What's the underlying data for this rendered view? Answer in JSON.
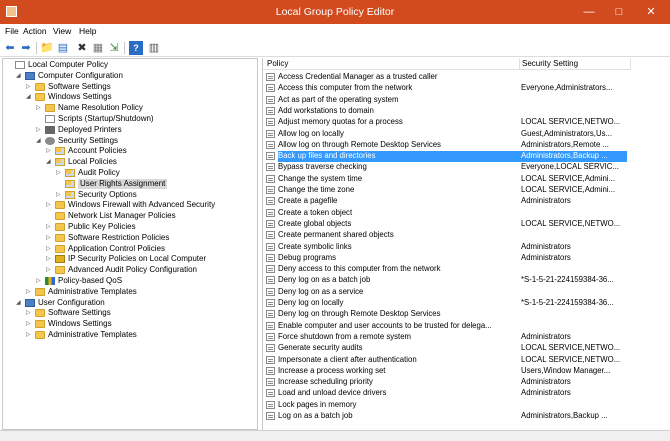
{
  "window": {
    "title": "Local Group Policy Editor",
    "minimize": "—",
    "maximize": "□",
    "close": "✕"
  },
  "menu": [
    "File",
    "Action",
    "View",
    "Help"
  ],
  "toolbar": [
    {
      "name": "back-icon",
      "glyph": "⬅"
    },
    {
      "name": "forward-icon",
      "glyph": "➡"
    },
    {
      "name": "up-folder-icon",
      "glyph": "📁"
    },
    {
      "name": "show-hide-tree-icon",
      "glyph": "▤"
    },
    {
      "name": "delete-icon",
      "glyph": "✖"
    },
    {
      "name": "properties-icon",
      "glyph": "▦"
    },
    {
      "name": "export-list-icon",
      "glyph": "⇲"
    },
    {
      "name": "help-icon",
      "glyph": "?"
    },
    {
      "name": "filter-icon",
      "glyph": "▥"
    }
  ],
  "tree": [
    {
      "label": "Local Computer Policy",
      "indent": 0,
      "arrow": "",
      "icon": "doc"
    },
    {
      "label": "Computer Configuration",
      "indent": 1,
      "arrow": "◢",
      "icon": "computer"
    },
    {
      "label": "Software Settings",
      "indent": 2,
      "arrow": "▷",
      "icon": "folder"
    },
    {
      "label": "Windows Settings",
      "indent": 2,
      "arrow": "◢",
      "icon": "folder"
    },
    {
      "label": "Name Resolution Policy",
      "indent": 3,
      "arrow": "▷",
      "icon": "folder"
    },
    {
      "label": "Scripts (Startup/Shutdown)",
      "indent": 3,
      "arrow": "",
      "icon": "doc"
    },
    {
      "label": "Deployed Printers",
      "indent": 3,
      "arrow": "▷",
      "icon": "printer"
    },
    {
      "label": "Security Settings",
      "indent": 3,
      "arrow": "◢",
      "icon": "gear"
    },
    {
      "label": "Account Policies",
      "indent": 4,
      "arrow": "▷",
      "icon": "policyfolder"
    },
    {
      "label": "Local Policies",
      "indent": 4,
      "arrow": "◢",
      "icon": "policyfolder"
    },
    {
      "label": "Audit Policy",
      "indent": 5,
      "arrow": "▷",
      "icon": "policyfolder"
    },
    {
      "label": "User Rights Assignment",
      "indent": 5,
      "arrow": "",
      "icon": "policyfolder",
      "selected": true
    },
    {
      "label": "Security Options",
      "indent": 5,
      "arrow": "▷",
      "icon": "policyfolder"
    },
    {
      "label": "Windows Firewall with Advanced Security",
      "indent": 4,
      "arrow": "▷",
      "icon": "folder"
    },
    {
      "label": "Network List Manager Policies",
      "indent": 4,
      "arrow": "",
      "icon": "folder"
    },
    {
      "label": "Public Key Policies",
      "indent": 4,
      "arrow": "▷",
      "icon": "folder"
    },
    {
      "label": "Software Restriction Policies",
      "indent": 4,
      "arrow": "▷",
      "icon": "folder"
    },
    {
      "label": "Application Control Policies",
      "indent": 4,
      "arrow": "▷",
      "icon": "folder"
    },
    {
      "label": "IP Security Policies on Local Computer",
      "indent": 4,
      "arrow": "▷",
      "icon": "lock"
    },
    {
      "label": "Advanced Audit Policy Configuration",
      "indent": 4,
      "arrow": "▷",
      "icon": "folder"
    },
    {
      "label": "Policy-based QoS",
      "indent": 3,
      "arrow": "▷",
      "icon": "chart"
    },
    {
      "label": "Administrative Templates",
      "indent": 2,
      "arrow": "▷",
      "icon": "folder"
    },
    {
      "label": "User Configuration",
      "indent": 1,
      "arrow": "◢",
      "icon": "computer"
    },
    {
      "label": "Software Settings",
      "indent": 2,
      "arrow": "▷",
      "icon": "folder"
    },
    {
      "label": "Windows Settings",
      "indent": 2,
      "arrow": "▷",
      "icon": "folder"
    },
    {
      "label": "Administrative Templates",
      "indent": 2,
      "arrow": "▷",
      "icon": "folder"
    }
  ],
  "columns": {
    "policy": "Policy",
    "setting": "Security Setting",
    "sort_indicator": "ˆ"
  },
  "policies": [
    {
      "name": "Access Credential Manager as a trusted caller",
      "setting": ""
    },
    {
      "name": "Access this computer from the network",
      "setting": "Everyone,Administrators..."
    },
    {
      "name": "Act as part of the operating system",
      "setting": ""
    },
    {
      "name": "Add workstations to domain",
      "setting": ""
    },
    {
      "name": "Adjust memory quotas for a process",
      "setting": "LOCAL SERVICE,NETWO..."
    },
    {
      "name": "Allow log on locally",
      "setting": "Guest,Administrators,Us..."
    },
    {
      "name": "Allow log on through Remote Desktop Services",
      "setting": "Administrators,Remote ..."
    },
    {
      "name": "Back up files and directories",
      "setting": "Administrators,Backup ...",
      "selected": true
    },
    {
      "name": "Bypass traverse checking",
      "setting": "Everyone,LOCAL SERVIC..."
    },
    {
      "name": "Change the system time",
      "setting": "LOCAL SERVICE,Admini..."
    },
    {
      "name": "Change the time zone",
      "setting": "LOCAL SERVICE,Admini..."
    },
    {
      "name": "Create a pagefile",
      "setting": "Administrators"
    },
    {
      "name": "Create a token object",
      "setting": ""
    },
    {
      "name": "Create global objects",
      "setting": "LOCAL SERVICE,NETWO..."
    },
    {
      "name": "Create permanent shared objects",
      "setting": ""
    },
    {
      "name": "Create symbolic links",
      "setting": "Administrators"
    },
    {
      "name": "Debug programs",
      "setting": "Administrators"
    },
    {
      "name": "Deny access to this computer from the network",
      "setting": ""
    },
    {
      "name": "Deny log on as a batch job",
      "setting": "*S-1-5-21-224159384-36..."
    },
    {
      "name": "Deny log on as a service",
      "setting": ""
    },
    {
      "name": "Deny log on locally",
      "setting": "*S-1-5-21-224159384-36..."
    },
    {
      "name": "Deny log on through Remote Desktop Services",
      "setting": ""
    },
    {
      "name": "Enable computer and user accounts to be trusted for delega...",
      "setting": ""
    },
    {
      "name": "Force shutdown from a remote system",
      "setting": "Administrators"
    },
    {
      "name": "Generate security audits",
      "setting": "LOCAL SERVICE,NETWO..."
    },
    {
      "name": "Impersonate a client after authentication",
      "setting": "LOCAL SERVICE,NETWO..."
    },
    {
      "name": "Increase a process working set",
      "setting": "Users,Window Manager..."
    },
    {
      "name": "Increase scheduling priority",
      "setting": "Administrators"
    },
    {
      "name": "Load and unload device drivers",
      "setting": "Administrators"
    },
    {
      "name": "Lock pages in memory",
      "setting": ""
    },
    {
      "name": "Log on as a batch job",
      "setting": "Administrators,Backup ..."
    }
  ]
}
